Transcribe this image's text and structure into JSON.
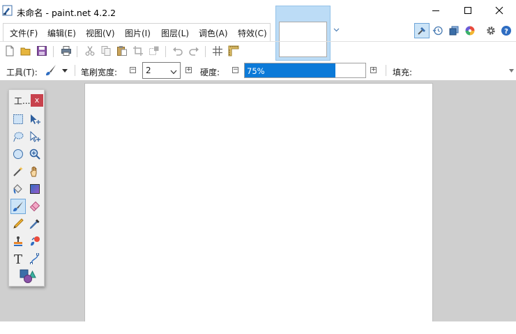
{
  "window": {
    "title": "未命名 - paint.net 4.2.2"
  },
  "menu": {
    "items": [
      "文件(F)",
      "编辑(E)",
      "视图(V)",
      "图片(I)",
      "图层(L)",
      "调色(A)",
      "特效(C)"
    ]
  },
  "tool_options": {
    "tool_label": "工具(T):",
    "brush_width_label": "笔刷宽度:",
    "brush_width_value": "2",
    "hardness_label": "硬度:",
    "hardness_value": "75%",
    "hardness_fraction": 0.75,
    "fill_label": "填充:"
  },
  "tools_window": {
    "title": "工...",
    "close_label": "x"
  },
  "colors": {
    "accent": "#0c7ad8",
    "close_red": "#c8424d",
    "selected_bg": "#cce4f7",
    "workspace": "#cfcfcf"
  },
  "icons": {
    "toolbar": [
      "new-file-icon",
      "open-folder-icon",
      "save-icon",
      "print-icon",
      "cut-icon",
      "copy-icon",
      "paste-icon",
      "crop-icon",
      "deselect-icon",
      "undo-icon",
      "redo-icon",
      "grid-icon",
      "ruler-icon"
    ],
    "right_group": [
      "tools-toggle-icon",
      "history-icon",
      "layers-icon",
      "colors-icon",
      "settings-icon",
      "help-icon"
    ],
    "tools": [
      "rectangle-select-icon",
      "move-selected-icon",
      "lasso-select-icon",
      "move-selection-icon",
      "ellipse-select-icon",
      "zoom-icon",
      "magic-wand-icon",
      "pan-icon",
      "paint-bucket-icon",
      "gradient-icon",
      "paintbrush-icon",
      "eraser-icon",
      "pencil-icon",
      "color-picker-icon",
      "clone-stamp-icon",
      "recolor-icon",
      "text-icon",
      "line-curve-icon",
      "shapes-icon"
    ]
  }
}
